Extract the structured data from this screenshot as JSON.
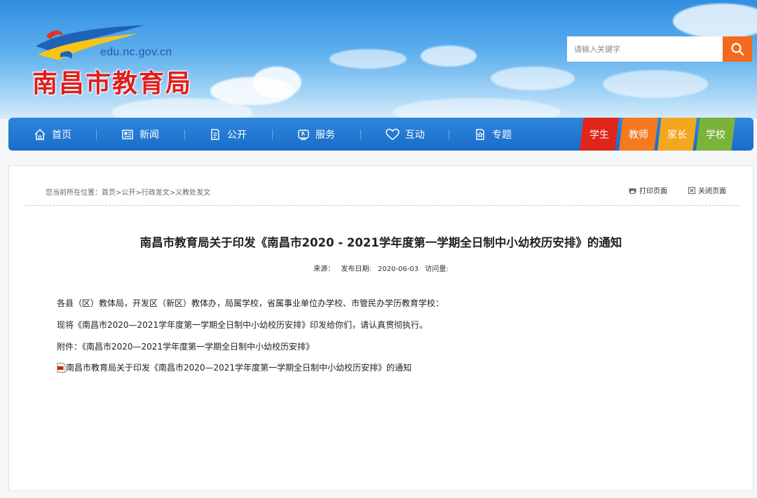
{
  "header": {
    "domain": "edu.nc.gov.cn",
    "site_name": "南昌市教育局",
    "search_placeholder": "请输入关键字"
  },
  "nav": {
    "items": [
      {
        "label": "首页",
        "icon": "home-icon"
      },
      {
        "label": "新闻",
        "icon": "newspaper-icon"
      },
      {
        "label": "公开",
        "icon": "document-icon"
      },
      {
        "label": "服务",
        "icon": "service-icon"
      },
      {
        "label": "互动",
        "icon": "heart-icon"
      },
      {
        "label": "专题",
        "icon": "topic-icon"
      }
    ],
    "tabs": [
      {
        "label": "学生",
        "color": "#e0251b"
      },
      {
        "label": "教师",
        "color": "#f47a1f"
      },
      {
        "label": "家长",
        "color": "#f2a71e"
      },
      {
        "label": "学校",
        "color": "#7bb33a"
      }
    ]
  },
  "breadcrumb": {
    "prefix": "您当前所在位置：",
    "path": "首页>公开>行政发文>义教处发文"
  },
  "tools": {
    "print": "打印页面",
    "close": "关闭页面"
  },
  "article": {
    "title": "南昌市教育局关于印发《南昌市2020 - 2021学年度第一学期全日制中小幼校历安排》的通知",
    "source_label": "来源：",
    "date_label": "发布日期:",
    "date": "2020-06-03",
    "visits_label": "访问量:",
    "paragraphs": [
      "各县（区）教体局，开发区（新区）教体办，局属学校，省属事业单位办学校、市管民办学历教育学校：",
      "现将《南昌市2020—2021学年度第一学期全日制中小幼校历安排》印发给你们，请认真贯彻执行。",
      "附件：《南昌市2020—2021学年度第一学期全日制中小幼校历安排》"
    ],
    "attachment": "南昌市教育局关于印发《南昌市2020—2021学年度第一学期全日制中小幼校历安排》的通知"
  },
  "colors": {
    "nav_blue": "#1a6cc8",
    "search_button": "#f26b1d",
    "site_name": "#e01d1d"
  }
}
